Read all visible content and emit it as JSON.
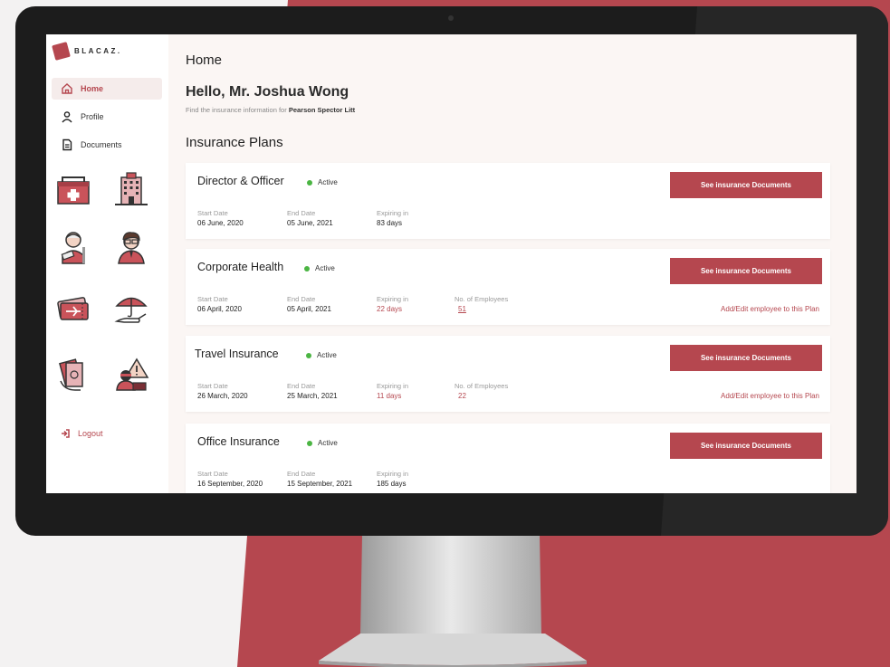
{
  "colors": {
    "accent": "#b5474f",
    "active": "#4bb543",
    "background_red": "#b5474f"
  },
  "sidebar": {
    "logo_text": "BLACAZ.",
    "items": [
      {
        "label": "Home",
        "icon": "home-icon",
        "active": true
      },
      {
        "label": "Profile",
        "icon": "user-icon",
        "active": false
      },
      {
        "label": "Documents",
        "icon": "document-icon",
        "active": false
      }
    ],
    "insurance_icons": [
      "first-aid-kit-icon",
      "office-building-icon",
      "injured-person-icon",
      "businessman-icon",
      "plane-ticket-icon",
      "umbrella-hand-icon",
      "money-hand-icon",
      "thief-warning-icon"
    ],
    "logout_label": "Logout"
  },
  "header": {
    "title": "Home"
  },
  "greeting": {
    "hello": "Hello, Mr. Joshua Wong",
    "subtitle_prefix": "Find the insurance information for ",
    "company": "Pearson Spector Litt"
  },
  "plans_title": "Insurance Plans",
  "labels": {
    "start_date": "Start Date",
    "end_date": "End Date",
    "expiring_in": "Expiring in",
    "employees": "No. of Employees",
    "see_docs": "See insurance Documents",
    "add_edit": "Add/Edit employee to this Plan"
  },
  "plans": [
    {
      "name": "Director & Officer",
      "status": "Active",
      "start": "06 June, 2020",
      "end": "05 June, 2021",
      "expiring": "83 days",
      "expiring_urgent": false,
      "employees": null
    },
    {
      "name": "Corporate Health",
      "status": "Active",
      "start": "06 April, 2020",
      "end": "05 April, 2021",
      "expiring": "22 days",
      "expiring_urgent": true,
      "employees": "51"
    },
    {
      "name": "Travel Insurance",
      "status": "Active",
      "start": "26 March, 2020",
      "end": "25 March, 2021",
      "expiring": "11 days",
      "expiring_urgent": true,
      "employees": "22"
    },
    {
      "name": "Office Insurance",
      "status": "Active",
      "start": "16 September, 2020",
      "end": "15 September, 2021",
      "expiring": "185 days",
      "expiring_urgent": false,
      "employees": null
    }
  ]
}
